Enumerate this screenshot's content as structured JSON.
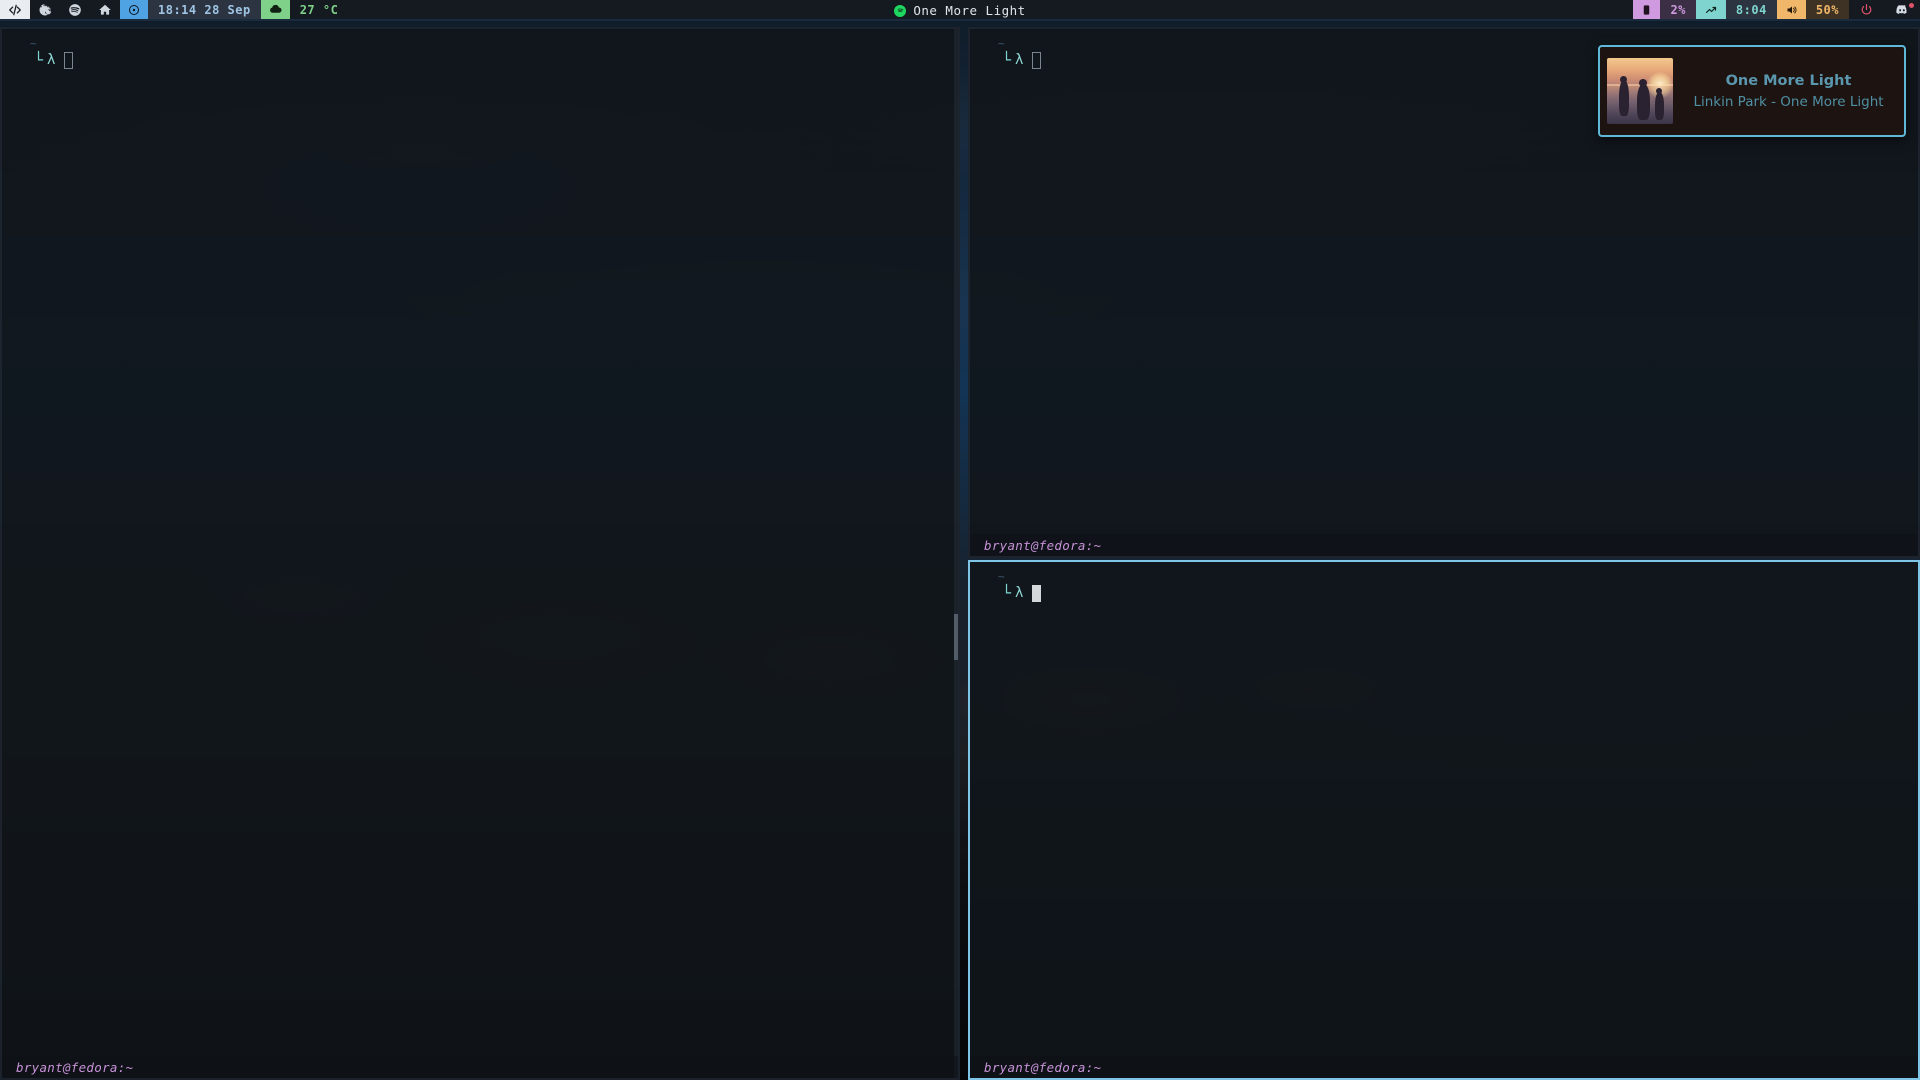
{
  "bar": {
    "launchers": [
      {
        "name": "code-icon",
        "label": "</>",
        "active": true
      },
      {
        "name": "firefox-icon",
        "label": "firefox",
        "active": false
      },
      {
        "name": "spotify-icon",
        "label": "spotify",
        "active": false
      },
      {
        "name": "home-icon",
        "label": "home",
        "active": false
      }
    ],
    "clock": {
      "icon": "clock-icon",
      "time": "18:14",
      "date": "28 Sep",
      "text": "18:14   28 Sep"
    },
    "weather": {
      "icon": "cloud-icon",
      "value": "27 °C"
    },
    "memory": {
      "icon": "memory-chip-icon",
      "value": "2%"
    },
    "network": {
      "icon": "trend-up-icon",
      "value": "8:04"
    },
    "volume": {
      "icon": "volume-icon",
      "value": "50%"
    },
    "power": {
      "icon": "power-icon",
      "label": "power"
    },
    "discord": {
      "icon": "discord-icon",
      "label": "discord",
      "has_badge": true
    },
    "center": {
      "icon": "spotify-icon",
      "title": "One More Light"
    },
    "colors": {
      "background": "#141a20",
      "clock_accent": "#4fa3e3",
      "weather_accent": "#7fd18a",
      "memory_accent": "#cf9ae0",
      "network_accent": "#7fd4cf",
      "volume_accent": "#f0b76a",
      "power_accent": "#e0516a",
      "spotify_green": "#1ed760"
    }
  },
  "windows": {
    "left": {
      "name": "terminal-left",
      "tilde": "~",
      "prompt": "└─λ",
      "status": "bryant@fedora:~",
      "focused": false
    },
    "top_right": {
      "name": "terminal-top-right",
      "tilde": "~",
      "prompt": "└─λ",
      "status": "bryant@fedora:~",
      "focused": false
    },
    "bottom_right": {
      "name": "terminal-bottom-right",
      "tilde": "~",
      "prompt": "└─λ",
      "status": "bryant@fedora:~",
      "focused": true
    }
  },
  "notification": {
    "name": "music-notification",
    "title": "One More Light",
    "subtitle": "Linkin Park - One More Light",
    "album_art": "album-art-one-more-light",
    "border_color": "#5fb8d8"
  }
}
